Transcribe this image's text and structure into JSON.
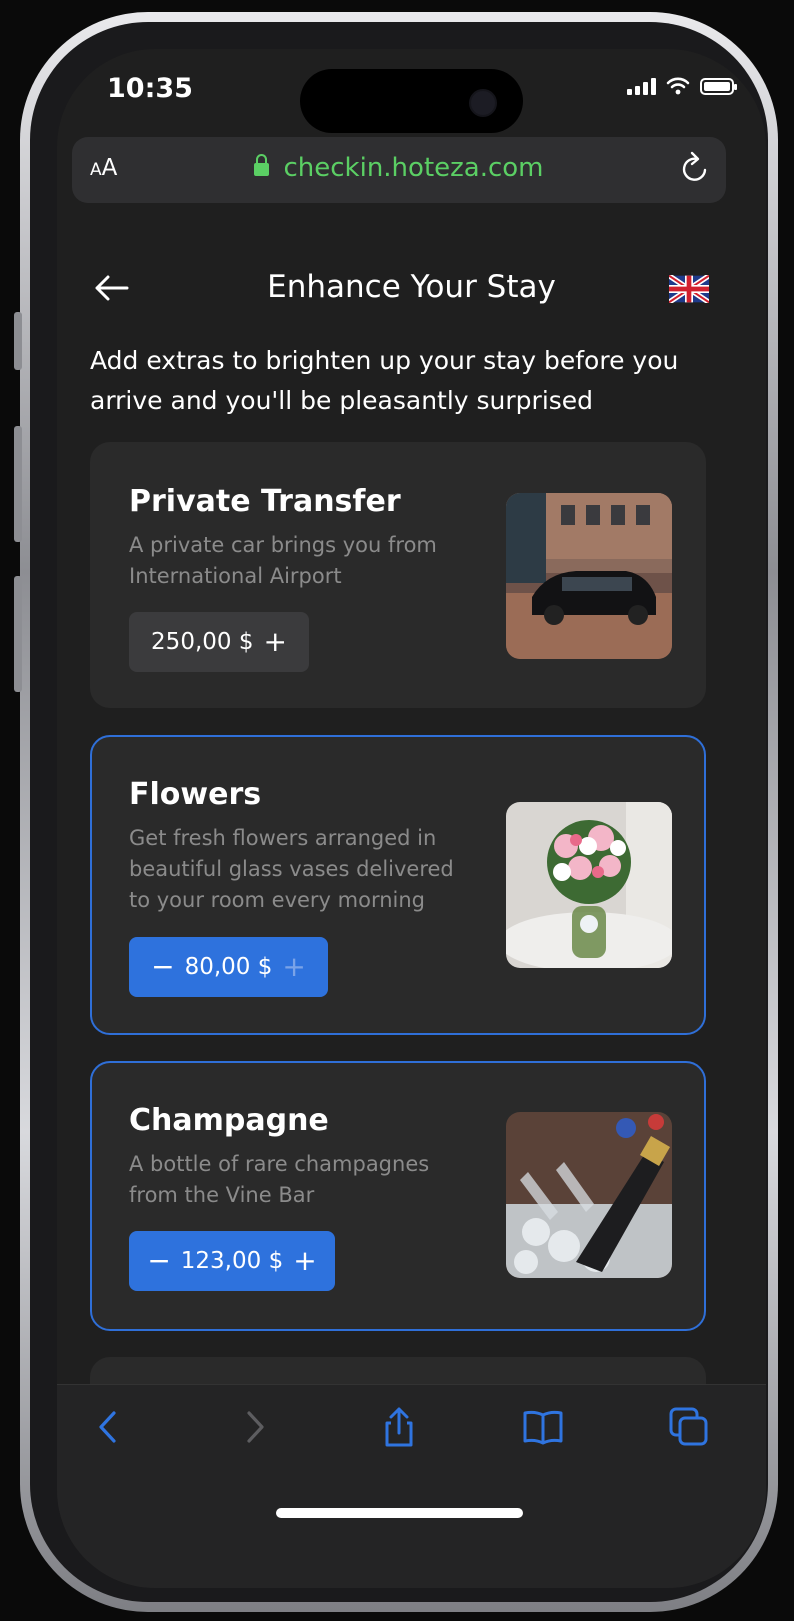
{
  "status_bar": {
    "time": "10:35"
  },
  "browser": {
    "text_size_label_small": "A",
    "text_size_label_large": "A",
    "url": "checkin.hoteza.com"
  },
  "page": {
    "title": "Enhance Your Stay",
    "intro": "Add extras to brighten up your stay before you arrive and you'll be pleasantly surprised"
  },
  "extras": [
    {
      "title": "Private Transfer",
      "description": "A private car brings you from International Airport",
      "price": "250,00 $",
      "selected": false,
      "image": "black-sedan-photo"
    },
    {
      "title": "Flowers",
      "description": "Get fresh flowers arranged in beautiful glass vases delivered to your room every morning",
      "price": "80,00 $",
      "selected": true,
      "image": "flower-vase-photo"
    },
    {
      "title": "Champagne",
      "description": "A bottle of rare champagnes from the Vine Bar",
      "price": "123,00 $",
      "selected": true,
      "image": "champagne-bucket-photo"
    }
  ],
  "controls": {
    "minus": "−",
    "plus": "+"
  },
  "colors": {
    "accent": "#2e72dd",
    "url_green": "#5bcf64",
    "card_bg": "#2a2a2a",
    "page_bg": "#1f1f1f"
  }
}
